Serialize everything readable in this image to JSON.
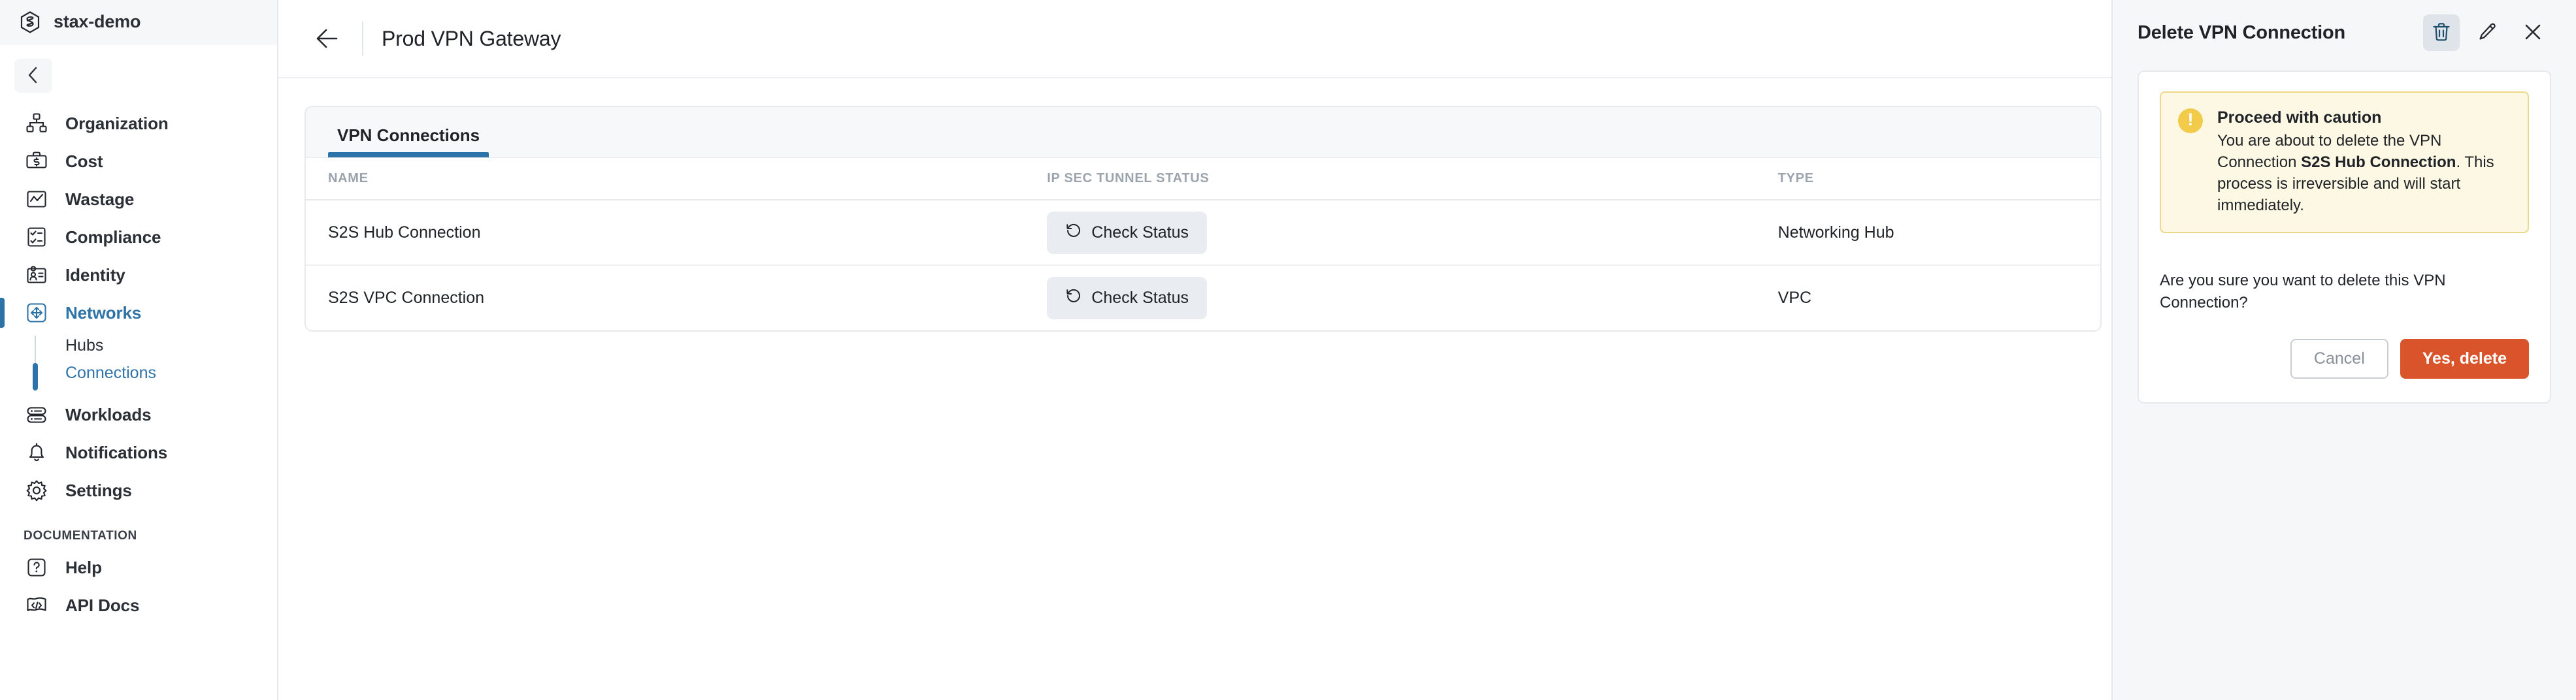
{
  "brand": {
    "name": "stax-demo",
    "logo_icon": "stax-hexagon-logo"
  },
  "sidebar": {
    "collapse_icon": "chevron-left-icon",
    "items": [
      {
        "label": "Organization",
        "icon": "org-chart-icon"
      },
      {
        "label": "Cost",
        "icon": "briefcase-dollar-icon"
      },
      {
        "label": "Wastage",
        "icon": "chart-line-icon"
      },
      {
        "label": "Compliance",
        "icon": "checklist-icon"
      },
      {
        "label": "Identity",
        "icon": "id-card-icon"
      },
      {
        "label": "Networks",
        "icon": "network-move-icon"
      }
    ],
    "sub_items": [
      {
        "label": "Hubs"
      },
      {
        "label": "Connections"
      }
    ],
    "items_lower": [
      {
        "label": "Workloads",
        "icon": "server-stack-icon"
      },
      {
        "label": "Notifications",
        "icon": "bell-icon"
      },
      {
        "label": "Settings",
        "icon": "gear-icon"
      }
    ],
    "section_label": "DOCUMENTATION",
    "doc_items": [
      {
        "label": "Help",
        "icon": "question-square-icon"
      },
      {
        "label": "API Docs",
        "icon": "code-flag-icon"
      }
    ],
    "accent_color": "#2e73a8"
  },
  "header": {
    "back_icon": "arrow-left-icon",
    "title": "Prod VPN Gateway"
  },
  "main": {
    "tabs": [
      {
        "label": "VPN Connections",
        "active": true
      }
    ],
    "table": {
      "columns": [
        "NAME",
        "IP SEC TUNNEL STATUS",
        "TYPE"
      ],
      "rows": [
        {
          "name": "S2S Hub Connection",
          "status_label": "Check Status",
          "status_icon": "refresh-ccw-icon",
          "type": "Networking Hub"
        },
        {
          "name": "S2S VPC Connection",
          "status_label": "Check Status",
          "status_icon": "refresh-ccw-icon",
          "type": "VPC"
        }
      ]
    }
  },
  "drawer": {
    "title": "Delete VPN Connection",
    "actions": [
      {
        "name": "delete",
        "icon": "trash-icon",
        "selected": true
      },
      {
        "name": "edit",
        "icon": "pencil-icon",
        "selected": false
      },
      {
        "name": "close",
        "icon": "close-icon",
        "selected": false
      }
    ],
    "alert": {
      "icon": "warning-exclamation-icon",
      "title": "Proceed with caution",
      "text_before": "You are about to delete the VPN Connection ",
      "emphasis": "S2S Hub Connection",
      "text_after": ". This process is irreversible and will start immediately.",
      "bg_color": "#fdf8e3",
      "border_color": "#ecd78a",
      "icon_color": "#f2cb4b"
    },
    "confirm_text": "Are you sure you want to delete this VPN Connection?",
    "cancel_label": "Cancel",
    "delete_label": "Yes, delete",
    "delete_color": "#d9542b"
  }
}
